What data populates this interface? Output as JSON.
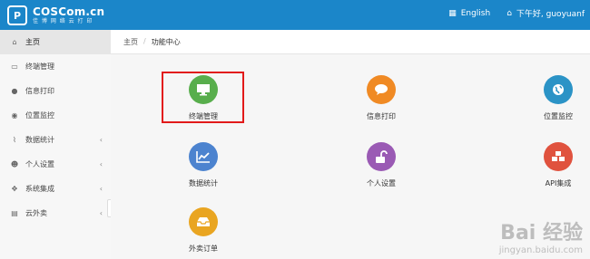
{
  "header": {
    "brand_name": "COSCom.cn",
    "brand_sub": "佳 博 网 络 云 打 印",
    "language": "English",
    "greeting": "下午好, guoyuanf"
  },
  "sidebar": {
    "items": [
      {
        "label": "主页",
        "icon": "home-icon"
      },
      {
        "label": "终端管理",
        "icon": "laptop-icon"
      },
      {
        "label": "信息打印",
        "icon": "comment-icon"
      },
      {
        "label": "位置监控",
        "icon": "globe-icon"
      },
      {
        "label": "数据统计",
        "icon": "chart-icon"
      },
      {
        "label": "个人设置",
        "icon": "user-icon"
      },
      {
        "label": "系统集成",
        "icon": "puzzle-icon"
      },
      {
        "label": "云外卖",
        "icon": "inbox-icon"
      }
    ],
    "toggle_glyph": "‹"
  },
  "breadcrumb": {
    "home": "主页",
    "separator": "/",
    "current": "功能中心"
  },
  "tiles": [
    {
      "label": "终端管理",
      "icon": "monitor-icon",
      "color": "#58ae4c"
    },
    {
      "label": "信息打印",
      "icon": "speech-bubble-icon",
      "color": "#f08a24"
    },
    {
      "label": "位置监控",
      "icon": "globe-icon",
      "color": "#2b93c6"
    },
    {
      "label": "数据统计",
      "icon": "line-chart-icon",
      "color": "#4c83cf"
    },
    {
      "label": "个人设置",
      "icon": "unlock-icon",
      "color": "#9a5ab4"
    },
    {
      "label": "API集成",
      "icon": "cubes-icon",
      "color": "#e0523e"
    },
    {
      "label": "外卖订单",
      "icon": "inbox-icon",
      "color": "#e9a521"
    }
  ],
  "watermark": {
    "line1": "Bai 经验",
    "line2": "jingyan.baidu.com"
  }
}
